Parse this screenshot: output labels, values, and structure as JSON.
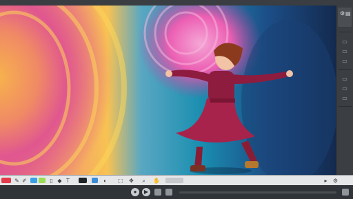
{
  "canvas": {
    "description_icon": "image-canvas"
  },
  "right_panel": {
    "icons": [
      "gear-icon",
      "layers-icon",
      "brush-icon",
      "eye-icon",
      "lock-icon",
      "grid-icon",
      "sliders-icon",
      "more-icon"
    ]
  },
  "toolbar": {
    "tool_icons": [
      "pen-icon",
      "brush-icon",
      "eraser-icon",
      "fill-icon",
      "text-icon",
      "shape-icon",
      "select-icon",
      "move-icon",
      "zoom-icon",
      "hand-icon"
    ],
    "swatches": [
      "#e23b4b",
      "#f7a83a",
      "#3aa0e6",
      "#9bdc55",
      "#1f2328",
      "#3b8bd6"
    ]
  },
  "bottombar": {
    "icons": [
      "play-icon",
      "record-icon",
      "camera-icon",
      "film-icon",
      "settings-icon",
      "fullscreen-icon"
    ]
  }
}
